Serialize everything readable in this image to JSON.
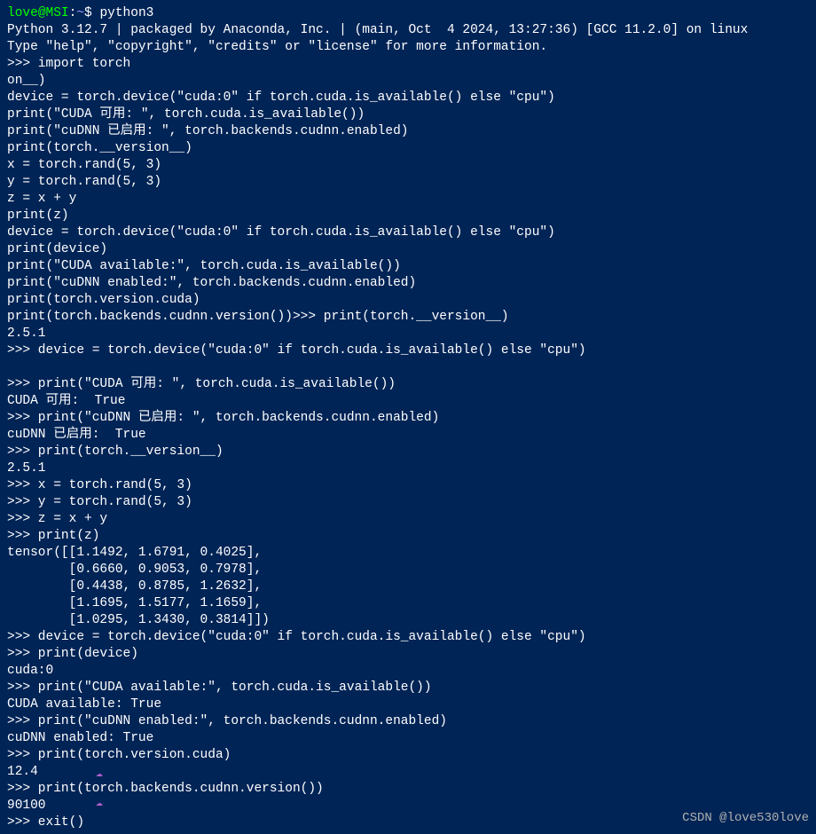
{
  "prompt": {
    "user": "love",
    "at": "@",
    "host": "MSI",
    "colon": ":",
    "path": "~",
    "dollar": "$",
    "command": "python3"
  },
  "lines": [
    "Python 3.12.7 | packaged by Anaconda, Inc. | (main, Oct  4 2024, 13:27:36) [GCC 11.2.0] on linux",
    "Type \"help\", \"copyright\", \"credits\" or \"license\" for more information.",
    ">>> import torch",
    "on__)",
    "device = torch.device(\"cuda:0\" if torch.cuda.is_available() else \"cpu\")",
    "print(\"CUDA 可用: \", torch.cuda.is_available())",
    "print(\"cuDNN 已启用: \", torch.backends.cudnn.enabled)",
    "print(torch.__version__)",
    "x = torch.rand(5, 3)",
    "y = torch.rand(5, 3)",
    "z = x + y",
    "print(z)",
    "device = torch.device(\"cuda:0\" if torch.cuda.is_available() else \"cpu\")",
    "print(device)",
    "print(\"CUDA available:\", torch.cuda.is_available())",
    "print(\"cuDNN enabled:\", torch.backends.cudnn.enabled)",
    "print(torch.version.cuda)",
    "print(torch.backends.cudnn.version())>>> print(torch.__version__)",
    "2.5.1",
    ">>> device = torch.device(\"cuda:0\" if torch.cuda.is_available() else \"cpu\")",
    "",
    ">>> print(\"CUDA 可用: \", torch.cuda.is_available())",
    "CUDA 可用:  True",
    ">>> print(\"cuDNN 已启用: \", torch.backends.cudnn.enabled)",
    "cuDNN 已启用:  True",
    ">>> print(torch.__version__)",
    "2.5.1",
    ">>> x = torch.rand(5, 3)",
    ">>> y = torch.rand(5, 3)",
    ">>> z = x + y",
    ">>> print(z)",
    "tensor([[1.1492, 1.6791, 0.4025],",
    "        [0.6660, 0.9053, 0.7978],",
    "        [0.4438, 0.8785, 1.2632],",
    "        [1.1695, 1.5177, 1.1659],",
    "        [1.0295, 1.3430, 0.3814]])",
    ">>> device = torch.device(\"cuda:0\" if torch.cuda.is_available() else \"cpu\")",
    ">>> print(device)",
    "cuda:0",
    ">>> print(\"CUDA available:\", torch.cuda.is_available())",
    "CUDA available: True",
    ">>> print(\"cuDNN enabled:\", torch.backends.cudnn.enabled)",
    "cuDNN enabled: True",
    ">>> print(torch.version.cuda)",
    "12.4",
    ">>> print(torch.backends.cudnn.version())",
    "90100",
    ">>> exit()"
  ],
  "watermark": "CSDN @love530love",
  "cloud_icon": "☁"
}
